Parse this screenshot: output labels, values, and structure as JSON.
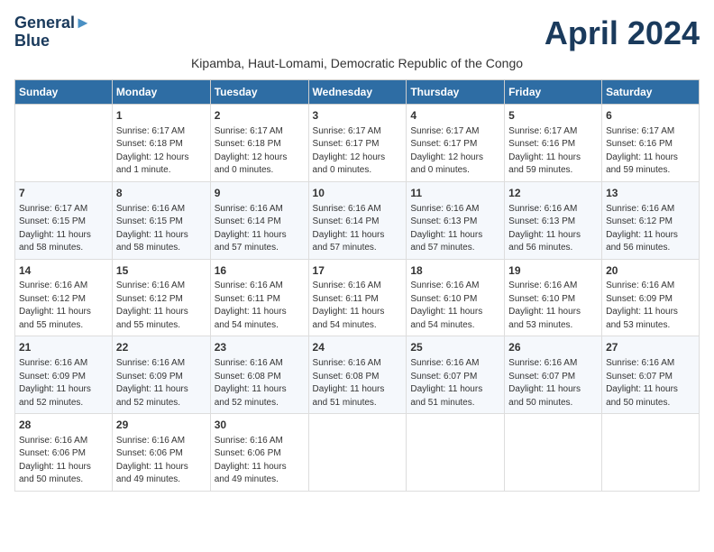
{
  "header": {
    "logo_line1": "General",
    "logo_line2": "Blue",
    "month_title": "April 2024",
    "subtitle": "Kipamba, Haut-Lomami, Democratic Republic of the Congo"
  },
  "days_of_week": [
    "Sunday",
    "Monday",
    "Tuesday",
    "Wednesday",
    "Thursday",
    "Friday",
    "Saturday"
  ],
  "weeks": [
    [
      {
        "num": "",
        "info": ""
      },
      {
        "num": "1",
        "info": "Sunrise: 6:17 AM\nSunset: 6:18 PM\nDaylight: 12 hours\nand 1 minute."
      },
      {
        "num": "2",
        "info": "Sunrise: 6:17 AM\nSunset: 6:18 PM\nDaylight: 12 hours\nand 0 minutes."
      },
      {
        "num": "3",
        "info": "Sunrise: 6:17 AM\nSunset: 6:17 PM\nDaylight: 12 hours\nand 0 minutes."
      },
      {
        "num": "4",
        "info": "Sunrise: 6:17 AM\nSunset: 6:17 PM\nDaylight: 12 hours\nand 0 minutes."
      },
      {
        "num": "5",
        "info": "Sunrise: 6:17 AM\nSunset: 6:16 PM\nDaylight: 11 hours\nand 59 minutes."
      },
      {
        "num": "6",
        "info": "Sunrise: 6:17 AM\nSunset: 6:16 PM\nDaylight: 11 hours\nand 59 minutes."
      }
    ],
    [
      {
        "num": "7",
        "info": "Sunrise: 6:17 AM\nSunset: 6:15 PM\nDaylight: 11 hours\nand 58 minutes."
      },
      {
        "num": "8",
        "info": "Sunrise: 6:16 AM\nSunset: 6:15 PM\nDaylight: 11 hours\nand 58 minutes."
      },
      {
        "num": "9",
        "info": "Sunrise: 6:16 AM\nSunset: 6:14 PM\nDaylight: 11 hours\nand 57 minutes."
      },
      {
        "num": "10",
        "info": "Sunrise: 6:16 AM\nSunset: 6:14 PM\nDaylight: 11 hours\nand 57 minutes."
      },
      {
        "num": "11",
        "info": "Sunrise: 6:16 AM\nSunset: 6:13 PM\nDaylight: 11 hours\nand 57 minutes."
      },
      {
        "num": "12",
        "info": "Sunrise: 6:16 AM\nSunset: 6:13 PM\nDaylight: 11 hours\nand 56 minutes."
      },
      {
        "num": "13",
        "info": "Sunrise: 6:16 AM\nSunset: 6:12 PM\nDaylight: 11 hours\nand 56 minutes."
      }
    ],
    [
      {
        "num": "14",
        "info": "Sunrise: 6:16 AM\nSunset: 6:12 PM\nDaylight: 11 hours\nand 55 minutes."
      },
      {
        "num": "15",
        "info": "Sunrise: 6:16 AM\nSunset: 6:12 PM\nDaylight: 11 hours\nand 55 minutes."
      },
      {
        "num": "16",
        "info": "Sunrise: 6:16 AM\nSunset: 6:11 PM\nDaylight: 11 hours\nand 54 minutes."
      },
      {
        "num": "17",
        "info": "Sunrise: 6:16 AM\nSunset: 6:11 PM\nDaylight: 11 hours\nand 54 minutes."
      },
      {
        "num": "18",
        "info": "Sunrise: 6:16 AM\nSunset: 6:10 PM\nDaylight: 11 hours\nand 54 minutes."
      },
      {
        "num": "19",
        "info": "Sunrise: 6:16 AM\nSunset: 6:10 PM\nDaylight: 11 hours\nand 53 minutes."
      },
      {
        "num": "20",
        "info": "Sunrise: 6:16 AM\nSunset: 6:09 PM\nDaylight: 11 hours\nand 53 minutes."
      }
    ],
    [
      {
        "num": "21",
        "info": "Sunrise: 6:16 AM\nSunset: 6:09 PM\nDaylight: 11 hours\nand 52 minutes."
      },
      {
        "num": "22",
        "info": "Sunrise: 6:16 AM\nSunset: 6:09 PM\nDaylight: 11 hours\nand 52 minutes."
      },
      {
        "num": "23",
        "info": "Sunrise: 6:16 AM\nSunset: 6:08 PM\nDaylight: 11 hours\nand 52 minutes."
      },
      {
        "num": "24",
        "info": "Sunrise: 6:16 AM\nSunset: 6:08 PM\nDaylight: 11 hours\nand 51 minutes."
      },
      {
        "num": "25",
        "info": "Sunrise: 6:16 AM\nSunset: 6:07 PM\nDaylight: 11 hours\nand 51 minutes."
      },
      {
        "num": "26",
        "info": "Sunrise: 6:16 AM\nSunset: 6:07 PM\nDaylight: 11 hours\nand 50 minutes."
      },
      {
        "num": "27",
        "info": "Sunrise: 6:16 AM\nSunset: 6:07 PM\nDaylight: 11 hours\nand 50 minutes."
      }
    ],
    [
      {
        "num": "28",
        "info": "Sunrise: 6:16 AM\nSunset: 6:06 PM\nDaylight: 11 hours\nand 50 minutes."
      },
      {
        "num": "29",
        "info": "Sunrise: 6:16 AM\nSunset: 6:06 PM\nDaylight: 11 hours\nand 49 minutes."
      },
      {
        "num": "30",
        "info": "Sunrise: 6:16 AM\nSunset: 6:06 PM\nDaylight: 11 hours\nand 49 minutes."
      },
      {
        "num": "",
        "info": ""
      },
      {
        "num": "",
        "info": ""
      },
      {
        "num": "",
        "info": ""
      },
      {
        "num": "",
        "info": ""
      }
    ]
  ]
}
